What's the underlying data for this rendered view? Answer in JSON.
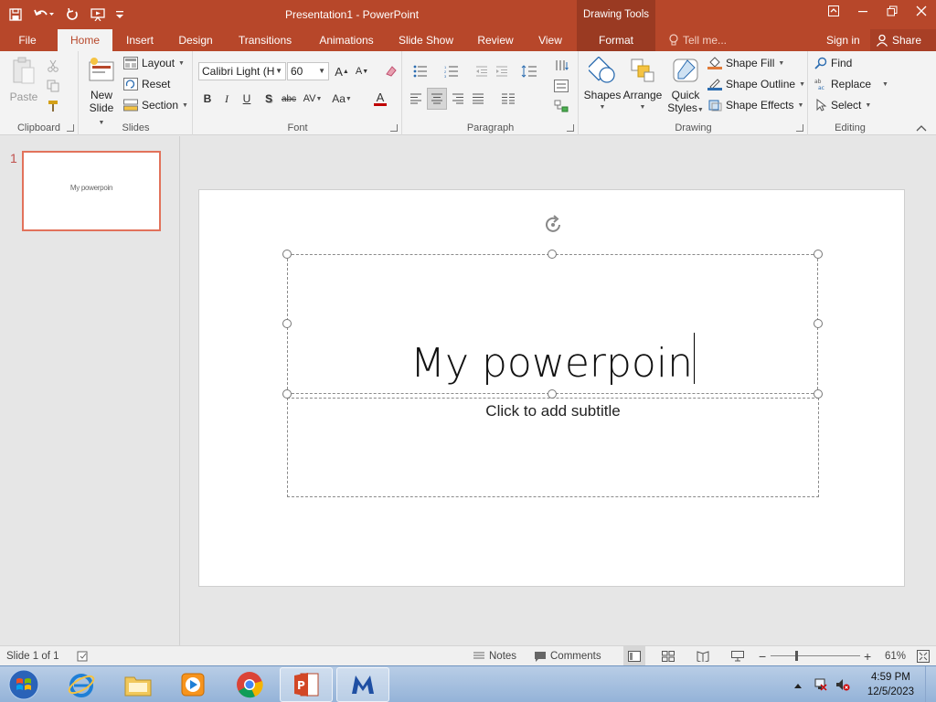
{
  "window": {
    "title": "Presentation1 - PowerPoint",
    "contextual_tab_group": "Drawing Tools"
  },
  "tabs": [
    {
      "label": "File"
    },
    {
      "label": "Home",
      "active": true
    },
    {
      "label": "Insert"
    },
    {
      "label": "Design"
    },
    {
      "label": "Transitions"
    },
    {
      "label": "Animations"
    },
    {
      "label": "Slide Show"
    },
    {
      "label": "Review"
    },
    {
      "label": "View"
    },
    {
      "label": "Format"
    }
  ],
  "tell_me": "Tell me...",
  "signin": "Sign in",
  "share": "Share",
  "ribbon": {
    "clipboard": {
      "label": "Clipboard",
      "paste": "Paste"
    },
    "slides": {
      "label": "Slides",
      "new_slide_1": "New",
      "new_slide_2": "Slide",
      "layout": "Layout",
      "reset": "Reset",
      "section": "Section"
    },
    "font": {
      "label": "Font",
      "font_name": "Calibri Light (H",
      "font_size": "60",
      "bold": "B",
      "italic": "I",
      "underline": "U",
      "shadow": "S",
      "strike": "abc",
      "spacing": "AV",
      "case": "Aa",
      "color": "A",
      "grow": "A",
      "shrink": "A"
    },
    "paragraph": {
      "label": "Paragraph"
    },
    "drawing": {
      "label": "Drawing",
      "shapes": "Shapes",
      "arrange": "Arrange",
      "quick_styles_1": "Quick",
      "quick_styles_2": "Styles",
      "shape_fill": "Shape Fill",
      "shape_outline": "Shape Outline",
      "shape_effects": "Shape Effects"
    },
    "editing": {
      "label": "Editing",
      "find": "Find",
      "replace": "Replace",
      "select": "Select"
    }
  },
  "thumbnail": {
    "number": "1",
    "text": "My powerpoin"
  },
  "slide": {
    "title_text": "My powerpoin",
    "subtitle_placeholder": "Click to add subtitle"
  },
  "status": {
    "slide_count": "Slide 1 of 1",
    "notes": "Notes",
    "comments": "Comments",
    "zoom": "61%"
  },
  "taskbar": {
    "time": "4:59 PM",
    "date": "12/5/2023"
  },
  "colors": {
    "accent": "#b7472a",
    "contextual": "#9a3a22"
  }
}
